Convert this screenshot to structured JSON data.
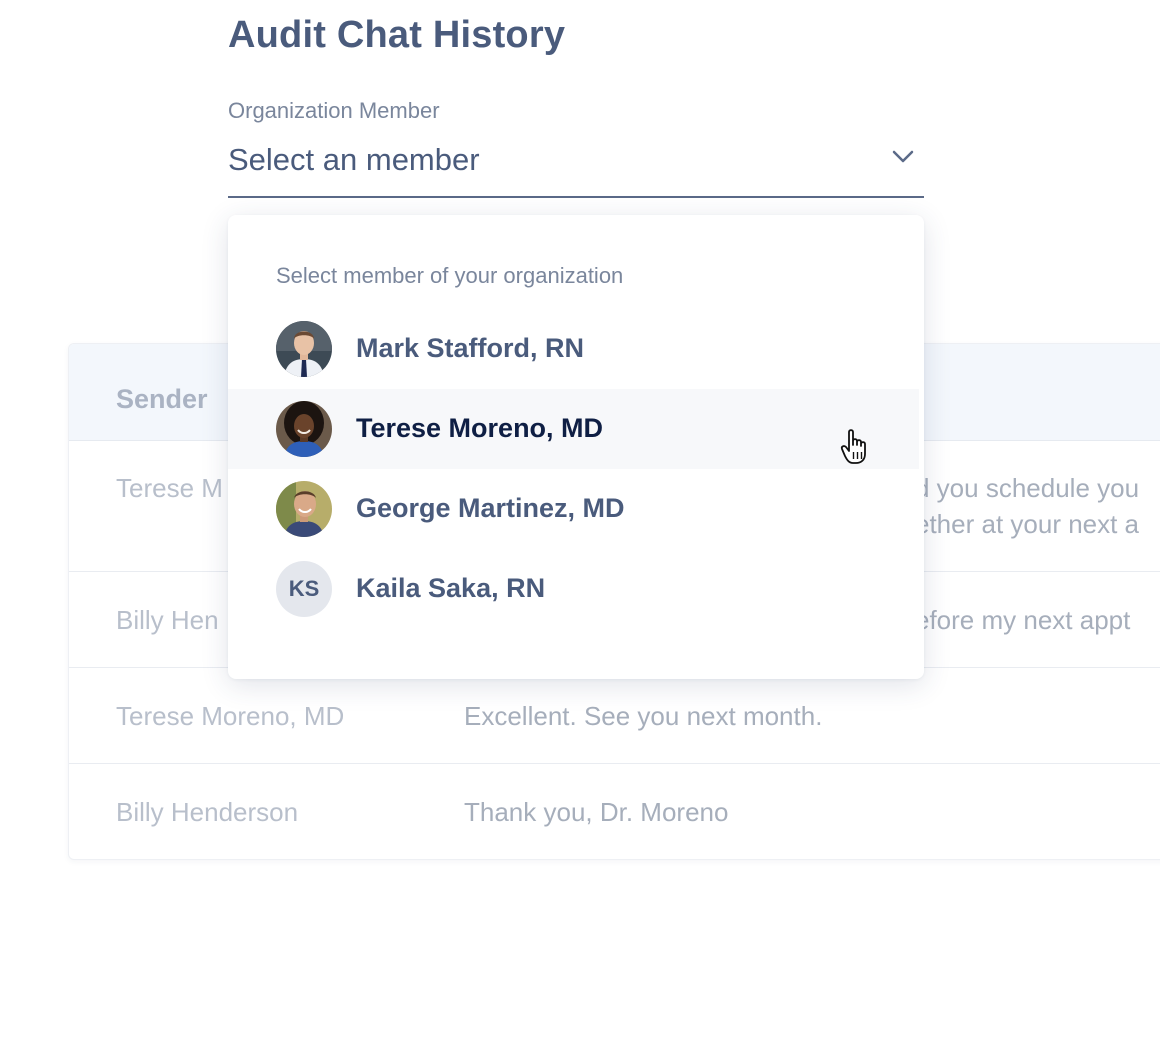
{
  "page": {
    "title": "Audit Chat History"
  },
  "member_select": {
    "label": "Organization Member",
    "value": "Select an member",
    "dropdown_header": "Select member of your organization",
    "options": [
      {
        "name": "Mark Stafford, RN",
        "avatar": "photo"
      },
      {
        "name": "Terese Moreno, MD",
        "avatar": "photo",
        "hovered": true
      },
      {
        "name": "George Martinez, MD",
        "avatar": "photo"
      },
      {
        "name": "Kaila Saka, RN",
        "avatar": "initials",
        "initials": "KS"
      }
    ]
  },
  "table": {
    "columns": [
      "Sender",
      ""
    ],
    "rows": [
      {
        "sender": "Terese M",
        "message": "d you schedule you\nether at your next a"
      },
      {
        "sender": "Billy Hen",
        "message": "efore my next appt"
      },
      {
        "sender": "Terese Moreno, MD",
        "message": "Excellent. See you next month."
      },
      {
        "sender": "Billy Henderson",
        "message": "Thank you, Dr. Moreno"
      }
    ]
  },
  "colors": {
    "accent": "#4a5b7c",
    "hover_row": "#f7f8fa",
    "table_header_bg": "#f3f7fc"
  },
  "icons": [
    "chevron-down-icon",
    "hand-pointer-cursor-icon"
  ]
}
